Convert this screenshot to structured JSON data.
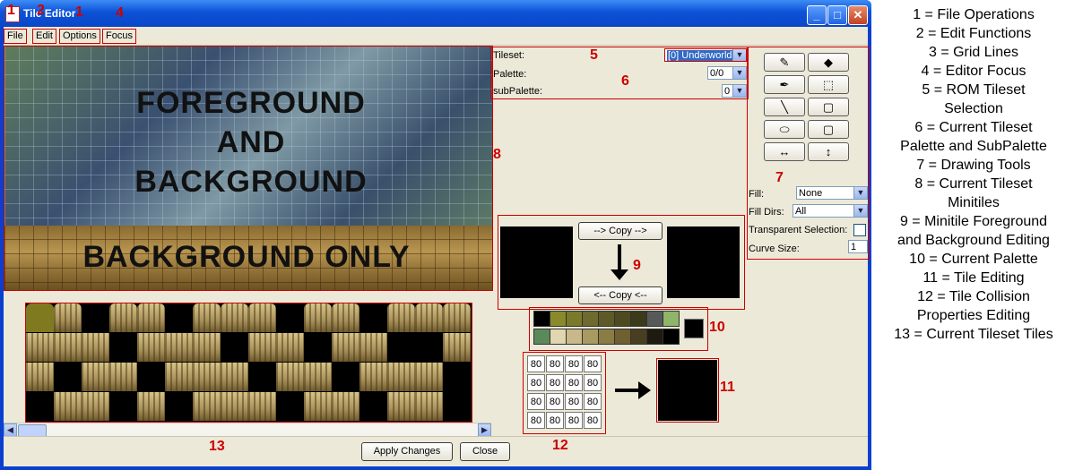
{
  "window": {
    "title": "Tile Editor"
  },
  "menu": {
    "file": "File",
    "edit": "Edit",
    "options": "Options",
    "focus": "Focus"
  },
  "markers": {
    "m1a": "1",
    "m2": "2",
    "m1b": "1",
    "m4": "4",
    "m5": "5",
    "m6": "6",
    "m7": "7",
    "m8": "8",
    "m9": "9",
    "m10": "10",
    "m11": "11",
    "m12": "12",
    "m13": "13"
  },
  "overlay": {
    "fg_line1": "FOREGROUND",
    "fg_line2": "AND",
    "fg_line3": "BACKGROUND",
    "bg_only": "BACKGROUND ONLY"
  },
  "selectors": {
    "tileset_label": "Tileset:",
    "tileset_value": "[0] Underworld",
    "palette_label": "Palette:",
    "palette_value": "0/0",
    "subpalette_label": "subPalette:",
    "subpalette_value": "0"
  },
  "tools": {
    "icons": [
      "pencil-icon",
      "fill-bucket-icon",
      "eyedropper-icon",
      "select-rect-icon",
      "line-icon",
      "rectangle-icon",
      "ellipse-icon",
      "rounded-rect-icon",
      "flip-horizontal-icon",
      "flip-vertical-icon"
    ],
    "glyphs": [
      "✎",
      "◆",
      "✒",
      "⬚",
      "╲",
      "▢",
      "⬭",
      "▢",
      "↔",
      "↕"
    ],
    "fill_label": "Fill:",
    "fill_value": "None",
    "filldirs_label": "Fill Dirs:",
    "filldirs_value": "All",
    "transparent_label": "Transparent Selection:",
    "curve_label": "Curve Size:",
    "curve_value": "1"
  },
  "copy": {
    "copy_right": "--> Copy -->",
    "copy_left": "<-- Copy <--"
  },
  "palette": {
    "colors": [
      "#000000",
      "#8a8a2a",
      "#7a7a2a",
      "#6e6a30",
      "#5d5a28",
      "#4e4a20",
      "#3b3a1a",
      "#575a5a",
      "#8fb56a",
      "#5a8a5a",
      "#e0d6b0",
      "#c8b88a",
      "#a89a60",
      "#8a7c45",
      "#6e6030",
      "#4a3e20",
      "#1e1a10",
      "#000000"
    ],
    "current": "#000000"
  },
  "collision": {
    "values": [
      "80",
      "80",
      "80",
      "80",
      "80",
      "80",
      "80",
      "80",
      "80",
      "80",
      "80",
      "80",
      "80",
      "80",
      "80",
      "80"
    ]
  },
  "footer": {
    "apply": "Apply Changes",
    "close": "Close"
  },
  "legend": [
    "1 = File Operations",
    "2 = Edit Functions",
    "3 = Grid Lines",
    "4 = Editor Focus",
    "5 = ROM Tileset",
    "Selection",
    "6 = Current Tileset",
    "Palette and SubPalette",
    "7 = Drawing Tools",
    "8 = Current Tileset",
    "Minitiles",
    "9 = Minitile Foreground",
    "and Background Editing",
    "10 = Current Palette",
    "11 = Tile Editing",
    "12 = Tile Collision",
    "Properties Editing",
    "13 = Current Tileset Tiles"
  ]
}
